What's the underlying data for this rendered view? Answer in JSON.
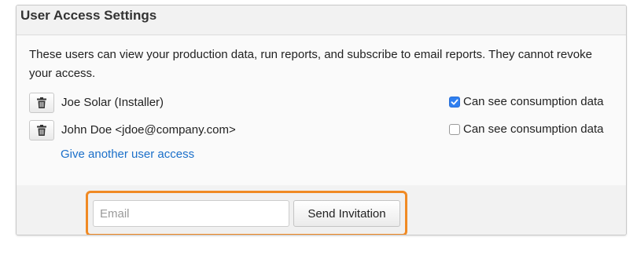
{
  "panel": {
    "title": "User Access Settings",
    "intro": "These users can view your production data, run reports, and subscribe to email reports. They cannot revoke your access."
  },
  "users": [
    {
      "name": "Joe Solar (Installer)",
      "consumption_label": "Can see consumption data",
      "consumption_checked": true
    },
    {
      "name": "John Doe <jdoe@company.com>",
      "consumption_label": "Can see consumption data",
      "consumption_checked": false
    }
  ],
  "icons": {
    "delete": "trash-icon",
    "check": "checkmark-icon"
  },
  "give_access_link": "Give another user access",
  "invite": {
    "email_value": "",
    "email_placeholder": "Email",
    "send_label": "Send Invitation"
  },
  "colors": {
    "link": "#1a6fc9",
    "highlight_border": "#f08a24",
    "checkbox_checked": "#2f7ff0"
  }
}
